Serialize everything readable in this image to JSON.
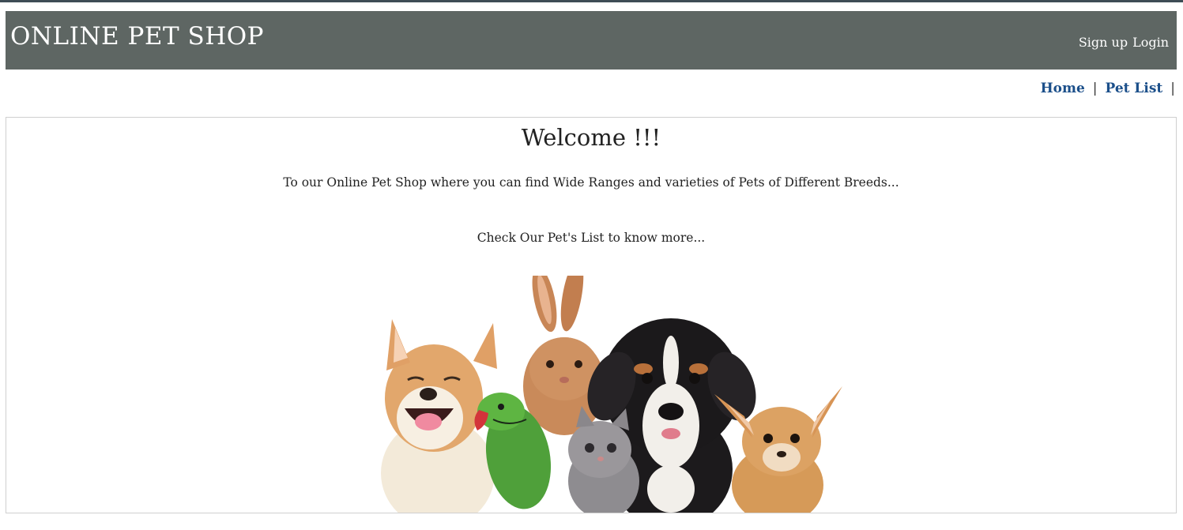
{
  "header": {
    "title": "ONLINE PET SHOP",
    "signup_label": "Sign up",
    "login_label": "Login"
  },
  "nav": {
    "home_label": "Home",
    "petlist_label": "Pet List",
    "separator": "|"
  },
  "main": {
    "heading": "Welcome !!!",
    "intro": "To our Online Pet Shop where you can find Wide Ranges and varieties of Pets of Different Breeds...",
    "cta_text": "Check Our Pet's List to know more..."
  },
  "hero_image": {
    "depicts": [
      "dog",
      "rabbit",
      "parrot",
      "kitten",
      "puppy",
      "chihuahua"
    ]
  },
  "colors": {
    "header_bg": "#5e6663",
    "top_strip": "#3e4d55",
    "nav_link": "#1b4f8a",
    "content_border": "#cfcfcf"
  }
}
